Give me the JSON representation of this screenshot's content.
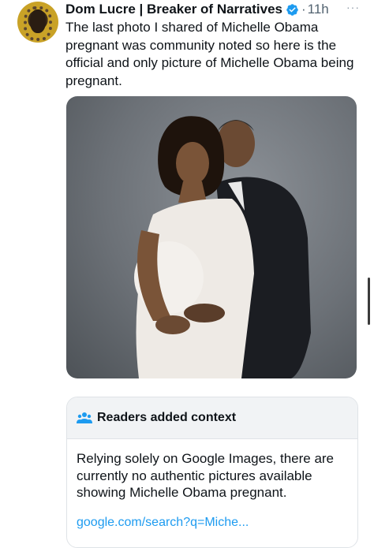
{
  "author": {
    "name": "Dom Lucre | Breaker of Narratives",
    "verified_icon": "verified-badge-icon",
    "dot": "·",
    "time": "11h",
    "avatar_icon": "avatar"
  },
  "more_icon": "···",
  "tweet": {
    "text": "The last photo I shared of Michelle Obama pregnant was community noted so here is the official and only picture of Michelle Obama being pregnant."
  },
  "context_note": {
    "icon": "people-icon",
    "title": "Readers added context",
    "body": "Relying solely on Google Images, there are currently no authentic pictures available showing Michelle Obama pregnant.",
    "link": "google.com/search?q=Miche..."
  },
  "colors": {
    "link": "#1d9bf0",
    "verified": "#1d9bf0",
    "muted": "#536471"
  }
}
